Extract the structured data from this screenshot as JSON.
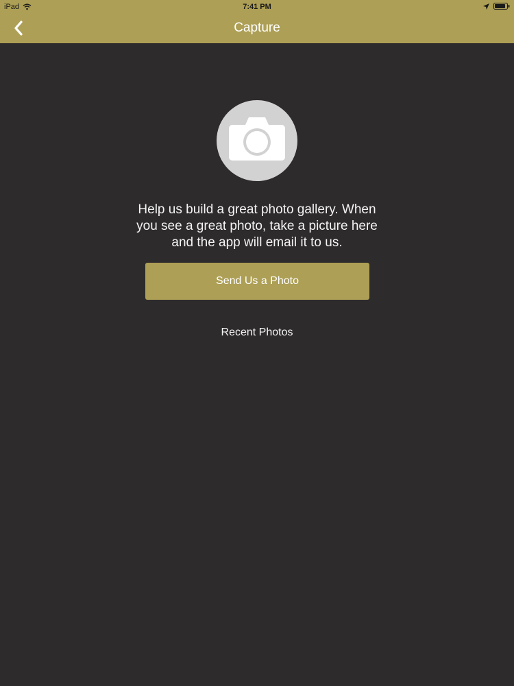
{
  "status_bar": {
    "device": "iPad",
    "time": "7:41 PM"
  },
  "nav": {
    "title": "Capture",
    "back_icon": "chevron-left-icon"
  },
  "content": {
    "camera_icon": "camera-icon",
    "message_lines": [
      "Help us build a great photo gallery. When",
      "you see a great photo, take a picture here",
      "and the app will email it to us."
    ],
    "send_button_label": "Send Us a Photo",
    "recent_photos_label": "Recent Photos"
  },
  "colors": {
    "header": "#ad9f55",
    "background": "#2e2b2c",
    "button": "#ad9f55",
    "camera_circle": "#d3d2d3"
  }
}
